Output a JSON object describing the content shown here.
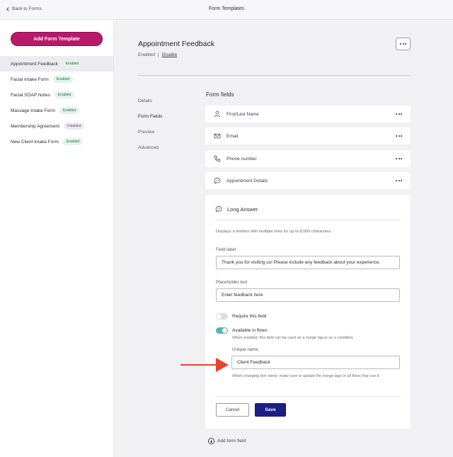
{
  "header": {
    "back_label": "Back to Forms",
    "title": "Form Templates"
  },
  "sidebar": {
    "add_button_label": "Add Form Template",
    "templates": [
      {
        "name": "Appointment Feedback",
        "status": "Enabled"
      },
      {
        "name": "Facial Intake Form",
        "status": "Enabled"
      },
      {
        "name": "Facial SOAP Notes",
        "status": "Enabled"
      },
      {
        "name": "Massage Intake Form",
        "status": "Enabled"
      },
      {
        "name": "Membership Agreement",
        "status": "Disabled"
      },
      {
        "name": "New Client Intake Form",
        "status": "Enabled"
      }
    ]
  },
  "form": {
    "title": "Appointment Feedback",
    "status": "Enabled",
    "separator": "|",
    "toggle_link": "Disable"
  },
  "subnav": {
    "items": [
      "Details",
      "Form Fields",
      "Preview",
      "Advanced"
    ],
    "active": "Form Fields"
  },
  "fields_section": {
    "heading": "Form fields",
    "fields": [
      {
        "label": "First/Last Name",
        "icon": "person-icon"
      },
      {
        "label": "Email",
        "icon": "envelope-icon"
      },
      {
        "label": "Phone number",
        "icon": "phone-icon"
      },
      {
        "label": "Appointment Details",
        "icon": "chat-bubble-icon"
      }
    ],
    "add_field_label": "Add form field"
  },
  "editor": {
    "type_label": "Long Answer",
    "description": "Displays a textbox with multiple lines for up to 5,000 characters.",
    "field_label_title": "Field label",
    "field_label_value": "Thank you for visiting us! Please include any feedback about your experience.",
    "placeholder_title": "Placeholder text",
    "placeholder_value": "Enter feedback here",
    "require_label": "Require this field",
    "require_on": false,
    "flows_label": "Available in flows",
    "flows_on": true,
    "flows_help": "When enabled, this field can be used as a merge tag or as a condition.",
    "unique_name_title": "Unique name",
    "unique_name_value": "Client Feedback",
    "unique_name_help": "When changing this name, make sure to update the merge tags in all flows that use it.",
    "cancel_label": "Cancel",
    "save_label": "Save"
  },
  "colors": {
    "brand": "#b81a6b",
    "primary": "#1e1f86",
    "toggle_on": "#57b6b0",
    "annotation_arrow": "#e8442c"
  }
}
